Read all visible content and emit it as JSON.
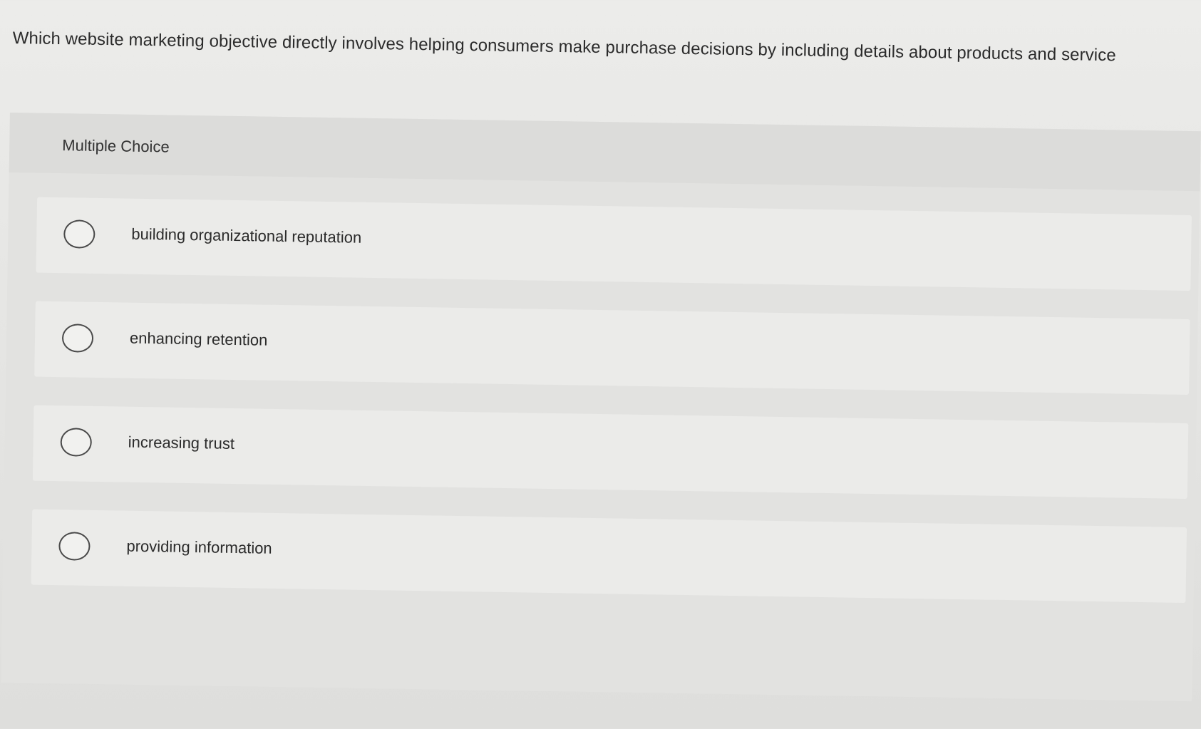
{
  "question": {
    "text": "Which website marketing objective directly involves helping consumers make purchase decisions by including details about products and service"
  },
  "panel": {
    "label": "Multiple Choice"
  },
  "options": [
    {
      "label": "building organizational reputation"
    },
    {
      "label": "enhancing retention"
    },
    {
      "label": "increasing trust"
    },
    {
      "label": "providing information"
    }
  ]
}
